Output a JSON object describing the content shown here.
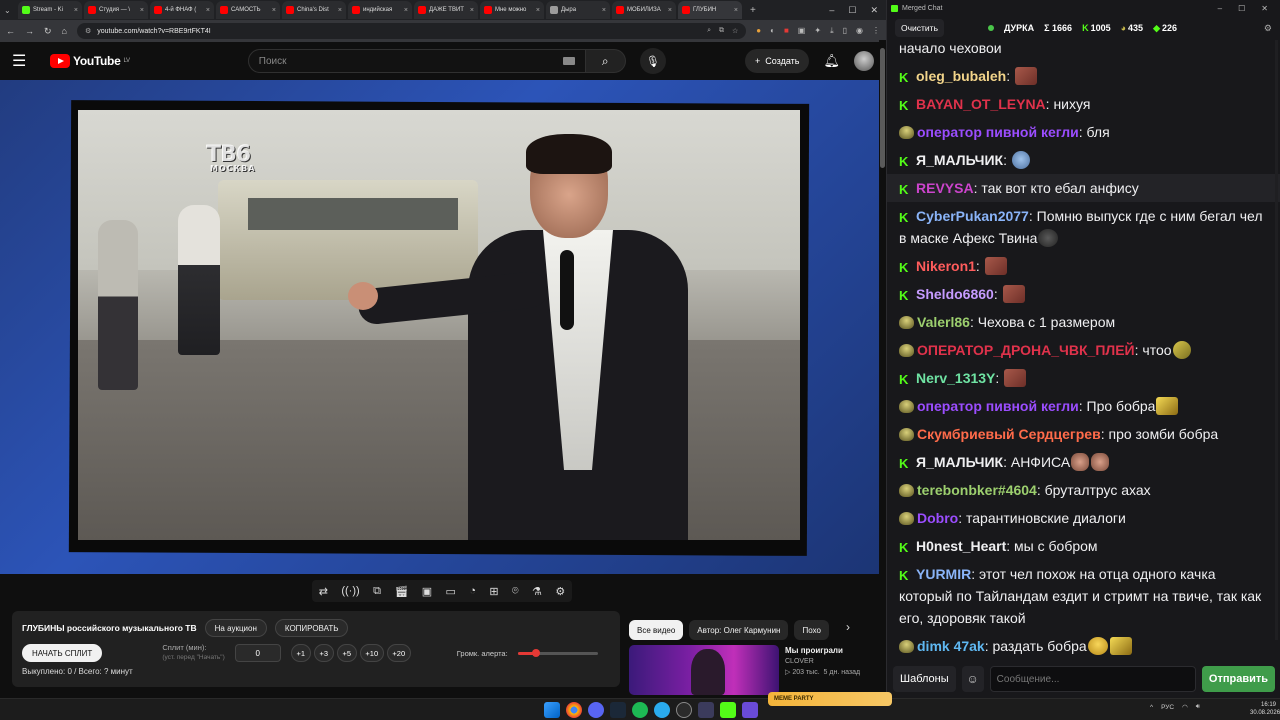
{
  "browser": {
    "tabs": [
      {
        "label": "Stream - Ki",
        "color": "#53fc18"
      },
      {
        "label": "Студия — \\",
        "color": "#ff0000"
      },
      {
        "label": "4-й ФНАФ (",
        "color": "#ff0000"
      },
      {
        "label": "САМОСТЬ",
        "color": "#ff0000"
      },
      {
        "label": "China's Dist",
        "color": "#ff0000"
      },
      {
        "label": "индийская",
        "color": "#ff0000"
      },
      {
        "label": "ДАЖЕ ТВИТ",
        "color": "#ff0000"
      },
      {
        "label": "Мне можно",
        "color": "#ff0000"
      },
      {
        "label": "Дыра",
        "color": "#9c9c9c"
      },
      {
        "label": "МОБИЛИЗА",
        "color": "#ff0000"
      },
      {
        "label": "ГЛУБИН",
        "color": "#ff0000"
      }
    ],
    "url": "youtube.com/watch?v=RBE9rtFKT4I"
  },
  "youtube": {
    "logo_text": "YouTube",
    "region": "LV",
    "search_placeholder": "Поиск",
    "create_label": "Создать"
  },
  "video": {
    "channel_bug_big": "ТВ6",
    "channel_bug_small": "МОСКВА"
  },
  "panel": {
    "title": "ГЛУБИНЫ российского музыкального ТВ",
    "auction_label": "На аукцион",
    "copy_label": "КОПИРОВАТЬ",
    "start_split_label": "НАЧАТЬ СПЛИТ",
    "split_label": "Сплит (мин):",
    "split_hint": "(уст. перед \"Начать\")",
    "split_value": "0",
    "increments": [
      "+1",
      "+3",
      "+5",
      "+10",
      "+20"
    ],
    "volume_label": "Громк. алерта:",
    "volume_level": 0.23,
    "status_text": "Выкуплено: 0 / Всего: ? минут"
  },
  "recommendations": {
    "tabs": [
      "Все видео",
      "Автор: Олег Кармунин",
      "Похо"
    ],
    "card": {
      "title": "Мы проиграли",
      "channel": "CLOVER",
      "views": "▷ 203 тыс.",
      "age": "5 дн. назад"
    }
  },
  "taskbar": {
    "badge_text": "MEME PARTY",
    "lang": "РУС",
    "time": "16:19",
    "date": "30.08.2026"
  },
  "chat": {
    "window_title": "Merged Chat",
    "clear_label": "Очистить",
    "channel": "ДУРКА",
    "stats": {
      "total": "Σ 1666",
      "kick": "1005",
      "twitch": "435",
      "other": "226"
    },
    "templates_label": "Шаблоны",
    "input_placeholder": "Сообщение...",
    "send_label": "Отправить",
    "messages": [
      {
        "badge": "none",
        "user": "",
        "color": "#efeff1",
        "text": "начало чеховои",
        "emote": ""
      },
      {
        "badge": "kick",
        "user": "oleg_bubaleh",
        "color": "#f2d48a",
        "text": "",
        "emote": "face"
      },
      {
        "badge": "kick",
        "user": "BAYAN_OT_LEYNA",
        "color": "#e0324b",
        "text": "нихуя",
        "emote": ""
      },
      {
        "badge": "twitch",
        "user": "оператор пивной кегли",
        "color": "#9b4dff",
        "text": "бля",
        "emote": ""
      },
      {
        "badge": "kick",
        "user": "Я_МАЛЬЧИК",
        "color": "#efeff1",
        "text": "",
        "emote": "sad"
      },
      {
        "badge": "kick",
        "user": "REVYSA",
        "color": "#cc44cc",
        "text": "так вот кто ебал анфису",
        "emote": "",
        "highlight": true
      },
      {
        "badge": "kick",
        "user": "CyberPukan2077",
        "color": "#8ab4f8",
        "text": "Помню выпуск где с ним бегал чел в маске Афекс Твина",
        "emote": "dark"
      },
      {
        "badge": "kick",
        "user": "Nikeron1",
        "color": "#ff5c5c",
        "text": "",
        "emote": "face"
      },
      {
        "badge": "kick",
        "user": "Sheldo6860",
        "color": "#c69bff",
        "text": "",
        "emote": "face"
      },
      {
        "badge": "twitch",
        "user": "Valerl86",
        "color": "#9ccf6e",
        "text": "Чехова с 1 размером",
        "emote": ""
      },
      {
        "badge": "twitch",
        "user": "ОПЕРАТОР_ДРОНА_ЧВК_ПЛЕЙ",
        "color": "#e0324b",
        "text": "чтоо",
        "emote": "yellow"
      },
      {
        "badge": "kick",
        "user": "Nerv_1313Y",
        "color": "#6fe3a3",
        "text": "",
        "emote": "face"
      },
      {
        "badge": "twitch",
        "user": "оператор пивной кегли",
        "color": "#9b4dff",
        "text": "Про бобра",
        "emote": "gold"
      },
      {
        "badge": "twitch",
        "user": "Скумбриевый Сердцегрев",
        "color": "#ff6b4a",
        "text": "про зомби бобра",
        "emote": ""
      },
      {
        "badge": "kick",
        "user": "Я_МАЛЬЧИК",
        "color": "#efeff1",
        "text": "АНФИСА",
        "emote": "hands"
      },
      {
        "badge": "twitch",
        "user": "terebonbker#4604",
        "color": "#9ccf6e",
        "text": "бруталтрус ахах",
        "emote": ""
      },
      {
        "badge": "twitch",
        "user": "Dobro",
        "color": "#9b4dff",
        "text": "тарантиновские диалоги",
        "emote": ""
      },
      {
        "badge": "kick",
        "user": "H0nest_Heart",
        "color": "#efeff1",
        "text": "мы с бобром",
        "emote": ""
      },
      {
        "badge": "kick",
        "user": "YURMIR",
        "color": "#8ab4f8",
        "text": "этот чел похож на отца одного качка который по Тайландам ездит и стримт на твиче, так как его, здоровяк такой",
        "emote": ""
      },
      {
        "badge": "twitch",
        "user": "dimk 47ak",
        "color": "#5fb8f2",
        "text": "раздать бобра",
        "emote": "laugh"
      }
    ]
  }
}
